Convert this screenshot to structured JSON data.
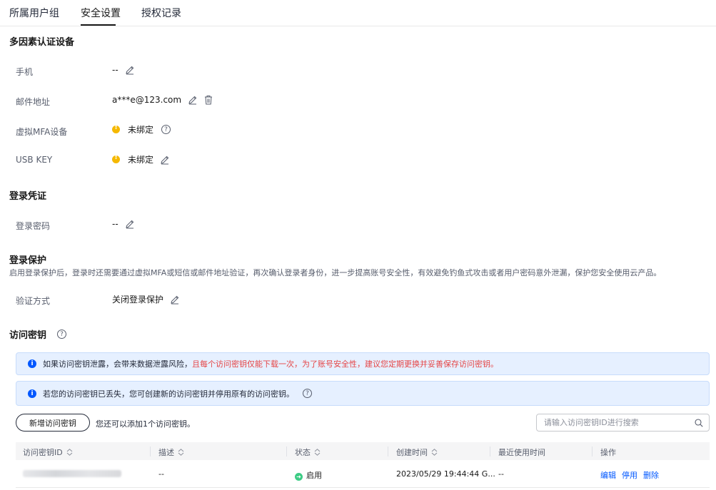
{
  "tabs": [
    "所属用户组",
    "安全设置",
    "授权记录"
  ],
  "mfa": {
    "title": "多因素认证设备",
    "phone": {
      "label": "手机",
      "value": "--"
    },
    "email": {
      "label": "邮件地址",
      "value": "a***e@123.com"
    },
    "virtual_mfa": {
      "label": "虚拟MFA设备",
      "value": "未绑定"
    },
    "usb_key": {
      "label": "USB KEY",
      "value": "未绑定"
    }
  },
  "login_credential": {
    "title": "登录凭证",
    "password": {
      "label": "登录密码",
      "value": "--"
    }
  },
  "login_protection": {
    "title": "登录保护",
    "description": "启用登录保护后，登录时还需要通过虚拟MFA或短信或邮件地址验证，再次确认登录者身份，进一步提高账号安全性，有效避免钓鱼式攻击或者用户密码意外泄漏，保护您安全使用云产品。",
    "method": {
      "label": "验证方式",
      "value": "关闭登录保护"
    }
  },
  "access_keys": {
    "title": "访问密钥",
    "alert1_prefix": "如果访问密钥泄露，会带来数据泄露风险，",
    "alert1_red": "且每个访问密钥仅能下载一次，为了账号安全性，建议您定期更换并妥善保存访问密钥。",
    "alert2": "若您的访问密钥已丢失，您可创建新的访问密钥并停用原有的访问密钥。",
    "add_button": "新增访问密钥",
    "hint": "您还可以添加1个访问密钥。",
    "search_placeholder": "请输入访问密钥ID进行搜索",
    "columns": [
      "访问密钥ID",
      "描述",
      "状态",
      "创建时间",
      "最近使用时间",
      "操作"
    ],
    "rows": [
      {
        "description": "--",
        "status": "启用",
        "created": "2023/05/29 19:44:44 G...",
        "last_used": "--",
        "actions": [
          "编辑",
          "停用",
          "删除"
        ]
      }
    ]
  },
  "colors": {
    "accent": "#0057ff",
    "warning": "#f5b800",
    "success": "#3dcc85",
    "danger": "#e54545",
    "alert_bg": "#e6f0ff"
  },
  "icons": [
    "edit-icon",
    "delete-icon",
    "help-icon",
    "warning-icon",
    "info-icon",
    "sort-icon",
    "search-icon",
    "status-enabled-icon"
  ]
}
